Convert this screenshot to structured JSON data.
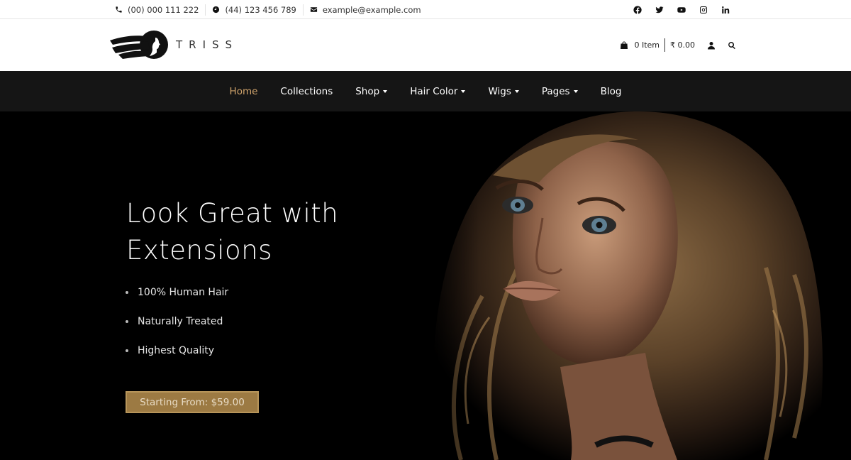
{
  "topbar": {
    "phone": "(00) 000 111 222",
    "hours": "(44) 123 456 789",
    "email": "example@example.com",
    "socials": [
      "facebook-icon",
      "twitter-icon",
      "youtube-icon",
      "instagram-icon",
      "linkedin-icon"
    ]
  },
  "brand": {
    "name": "TRISS"
  },
  "header": {
    "cart_label": "0 Item",
    "cart_total": "₹ 0.00"
  },
  "nav": {
    "items": [
      {
        "label": "Home",
        "active": true,
        "dropdown": false
      },
      {
        "label": "Collections",
        "active": false,
        "dropdown": false
      },
      {
        "label": "Shop",
        "active": false,
        "dropdown": true
      },
      {
        "label": "Hair Color",
        "active": false,
        "dropdown": true
      },
      {
        "label": "Wigs",
        "active": false,
        "dropdown": true
      },
      {
        "label": "Pages",
        "active": false,
        "dropdown": true
      },
      {
        "label": "Blog",
        "active": false,
        "dropdown": false
      }
    ]
  },
  "hero": {
    "title_line1": "Look Great with",
    "title_line2": "Extensions",
    "features": [
      "100% Human Hair",
      "Naturally Treated",
      "Highest Quality"
    ],
    "cta_label": "Starting From: $59.00"
  },
  "colors": {
    "accent": "#d0a36b",
    "button": "#9c7a43",
    "nav_bg": "#151515"
  }
}
